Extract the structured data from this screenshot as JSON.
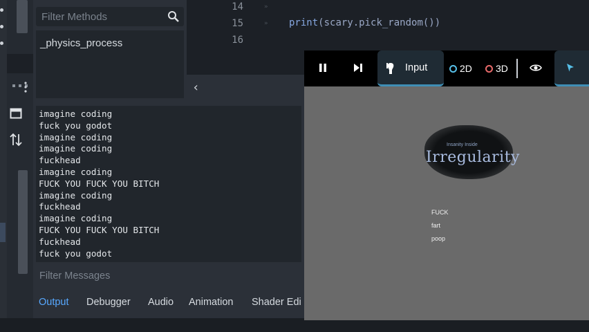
{
  "method_panel": {
    "filter_placeholder": "Filter Methods",
    "method": "_physics_process"
  },
  "editor": {
    "line_numbers": [
      "14",
      "15",
      "16"
    ],
    "code": {
      "func": "print",
      "args": "(scary.pick_random())"
    }
  },
  "output": {
    "lines": [
      "imagine coding",
      "fuck you godot",
      "imagine coding",
      "imagine coding",
      "fuckhead",
      "imagine coding",
      "FUCK YOU FUCK YOU BITCH",
      "imagine coding",
      "fuckhead",
      "imagine coding",
      "FUCK YOU FUCK YOU BITCH",
      "fuckhead",
      "fuck you godot"
    ],
    "filter_placeholder": "Filter Messages"
  },
  "bottom_tabs": [
    "Output",
    "Debugger",
    "Audio",
    "Animation",
    "Shader Edi"
  ],
  "game_toolbar": {
    "input": "Input",
    "mode_2d": "2D",
    "mode_3d": "3D"
  },
  "game": {
    "logo_subtitle": "Insanity Inside",
    "logo_title": "Irregularity",
    "menu": [
      "FUCK",
      "fart",
      "poop"
    ]
  }
}
